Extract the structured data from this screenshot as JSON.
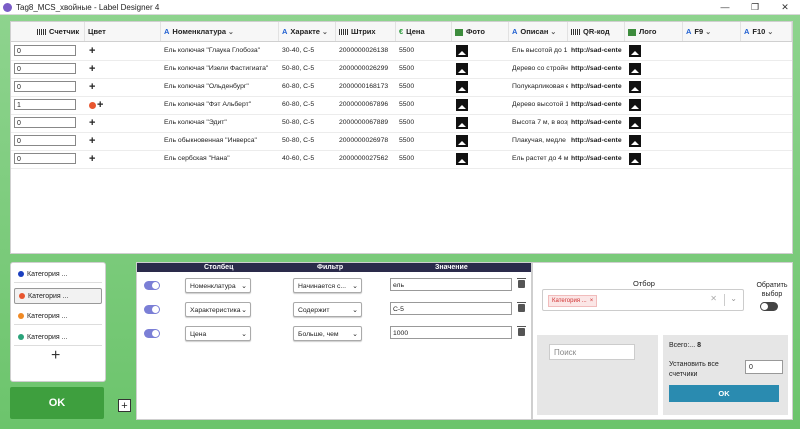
{
  "window": {
    "title": "Tag8_MCS_хвойные - Label Designer 4",
    "controls": [
      "—",
      "❐",
      "✕"
    ]
  },
  "grid": {
    "columns": [
      {
        "key": "counter",
        "label": "Счетчик",
        "icon": "counter-icon"
      },
      {
        "key": "color",
        "label": "Цвет",
        "icon": ""
      },
      {
        "key": "nomenclature",
        "label": "Номенклатура",
        "icon": "text-icon"
      },
      {
        "key": "characteristic",
        "label": "Характе",
        "icon": "text-icon"
      },
      {
        "key": "barcode",
        "label": "Штрих",
        "icon": "barcode-icon"
      },
      {
        "key": "price",
        "label": "Цена",
        "icon": "money-icon"
      },
      {
        "key": "photo",
        "label": "Фото",
        "icon": "image-icon"
      },
      {
        "key": "description",
        "label": "Описан",
        "icon": "text-icon"
      },
      {
        "key": "qr",
        "label": "QR-код",
        "icon": "barcode-icon"
      },
      {
        "key": "logo",
        "label": "Лого",
        "icon": "image-icon"
      },
      {
        "key": "f9",
        "label": "F9",
        "icon": "text-icon"
      },
      {
        "key": "f10",
        "label": "F10",
        "icon": "text-icon"
      }
    ],
    "rows": [
      {
        "counter": "0",
        "color_dot": "",
        "nomenclature": "Ель колючая \"Глаука Глобоза\"",
        "characteristic": "30-40, C-5",
        "barcode": "2000000026138",
        "price": "5500",
        "description": "Ель высотой до 1,",
        "qr": "http://sad-cente"
      },
      {
        "counter": "0",
        "color_dot": "",
        "nomenclature": "Ель колючая \"Изели Фастигиата\"",
        "characteristic": "50-80, C-5",
        "barcode": "2000000026299",
        "price": "5500",
        "description": "Дерево со стройн",
        "qr": "http://sad-cente"
      },
      {
        "counter": "0",
        "color_dot": "",
        "nomenclature": "Ель колючая \"Ольденбург\"",
        "characteristic": "60-80, C-5",
        "barcode": "2000000168173",
        "price": "5500",
        "description": "Полукарликовая е",
        "qr": "http://sad-cente"
      },
      {
        "counter": "1",
        "color_dot": "#e8562f",
        "nomenclature": "Ель колючая \"Фэт Альберт\"",
        "characteristic": "60-80, C-5",
        "barcode": "2000000067896",
        "price": "5500",
        "description": "Дерево высотой 1",
        "qr": "http://sad-cente"
      },
      {
        "counter": "0",
        "color_dot": "",
        "nomenclature": "Ель колючая \"Эдит\"",
        "characteristic": "50-80, C-5",
        "barcode": "2000000067889",
        "price": "5500",
        "description": "Высота 7 м, в возр",
        "qr": "http://sad-cente"
      },
      {
        "counter": "0",
        "color_dot": "",
        "nomenclature": "Ель обыкновенная \"Инверса\"",
        "characteristic": "50-80, C-5",
        "barcode": "2000000026978",
        "price": "5500",
        "description": "Плакучая, медле",
        "qr": "http://sad-cente"
      },
      {
        "counter": "0",
        "color_dot": "",
        "nomenclature": "Ель сербская \"Нана\"",
        "characteristic": "40-60, C-5",
        "barcode": "2000000027562",
        "price": "5500",
        "description": "Ель растет до 4 м",
        "qr": "http://sad-cente"
      }
    ]
  },
  "categories": {
    "items": [
      {
        "label": "Категория ...",
        "color": "#1a3fbf",
        "selected": false
      },
      {
        "label": "Категория ...",
        "color": "#e8562f",
        "selected": true
      },
      {
        "label": "Категория ...",
        "color": "#f08a24",
        "selected": false
      },
      {
        "label": "Категория ...",
        "color": "#2aa37a",
        "selected": false
      }
    ],
    "add_label": "+"
  },
  "ok_main_label": "OK",
  "add_filter_label": "+",
  "filters": {
    "headers": {
      "column": "Столбец",
      "filter": "Фильтр",
      "value": "Значение"
    },
    "rows": [
      {
        "column": "Номенклатура",
        "filter": "Начинается с...",
        "value": "ель"
      },
      {
        "column": "Характеристика",
        "filter": "Содержит",
        "value": "C-5"
      },
      {
        "column": "Цена",
        "filter": "Больше, чем",
        "value": "1000"
      }
    ]
  },
  "selection": {
    "label": "Отбор",
    "chip": "Категория ...",
    "invert_label": "Обратить выбор"
  },
  "search": {
    "placeholder": "Поиск"
  },
  "summary": {
    "total_label": "Всего:...",
    "total_value": "8",
    "set_all_label": "Установить все счетчики",
    "set_all_value": "0",
    "ok_label": "OK"
  }
}
